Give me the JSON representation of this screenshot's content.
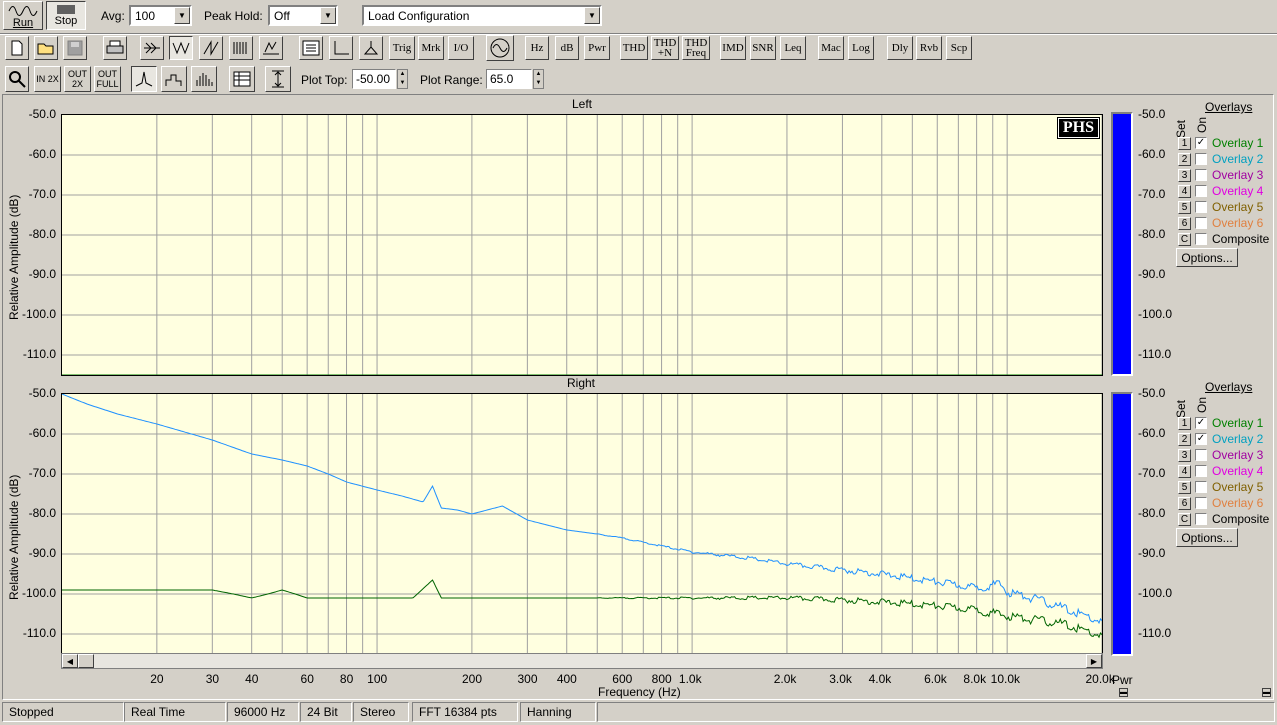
{
  "toolbar1": {
    "run": "Run",
    "stop": "Stop",
    "avg_label": "Avg:",
    "avg_value": "100",
    "peak_label": "Peak Hold:",
    "peak_value": "Off",
    "config_value": "Load Configuration"
  },
  "toolbar2": {
    "buttons": [
      "Trig",
      "Mrk",
      "I/O",
      "Hz",
      "dB",
      "Pwr",
      "THD",
      "THD +N",
      "THD Freq",
      "IMD",
      "SNR",
      "Leq",
      "Mac",
      "Log",
      "Dly",
      "Rvb",
      "Scp"
    ]
  },
  "toolbar3": {
    "plot_top_label": "Plot Top:",
    "plot_top_value": "-50.00",
    "plot_range_label": "Plot Range:",
    "plot_range_value": "65.0",
    "zoom_labels": [
      "IN 2X",
      "OUT 2X",
      "OUT FULL"
    ]
  },
  "left_panel": {
    "title": "Left",
    "ylabel": "Relative Amplitude (dB)",
    "logo": "PHS"
  },
  "right_panel": {
    "title": "Right",
    "ylabel": "Relative Amplitude (dB)"
  },
  "y_ticks": [
    "-50.0",
    "-60.0",
    "-70.0",
    "-80.0",
    "-90.0",
    "-100.0",
    "-110.0"
  ],
  "x_ticks": [
    "20",
    "30",
    "40",
    "60",
    "80",
    "100",
    "200",
    "300",
    "400",
    "600",
    "800",
    "1.0k",
    "2.0k",
    "3.0k",
    "4.0k",
    "6.0k",
    "8.0k",
    "10.0k",
    "20.0k"
  ],
  "xlabel": "Frequency (Hz)",
  "meter_label": "Pwr",
  "overlays": {
    "header": "Overlays",
    "set_label": "Set",
    "on_label": "On",
    "options": "Options...",
    "items": [
      {
        "set": "1",
        "name": "Overlay 1",
        "color": "#008000",
        "checked_left": true,
        "checked_right": true
      },
      {
        "set": "2",
        "name": "Overlay 2",
        "color": "#00a0c0",
        "checked_left": false,
        "checked_right": true
      },
      {
        "set": "3",
        "name": "Overlay 3",
        "color": "#a000a0",
        "checked_left": false,
        "checked_right": false
      },
      {
        "set": "4",
        "name": "Overlay 4",
        "color": "#e000e0",
        "checked_left": false,
        "checked_right": false
      },
      {
        "set": "5",
        "name": "Overlay 5",
        "color": "#806000",
        "checked_left": false,
        "checked_right": false
      },
      {
        "set": "6",
        "name": "Overlay 6",
        "color": "#e08040",
        "checked_left": false,
        "checked_right": false
      },
      {
        "set": "C",
        "name": "Composite",
        "color": "#000000",
        "checked_left": false,
        "checked_right": false
      }
    ]
  },
  "status": [
    "Stopped",
    "Real Time",
    "96000 Hz",
    "24 Bit",
    "Stereo",
    "FFT 16384 pts",
    "Hanning"
  ],
  "chart_data": [
    {
      "type": "line",
      "title": "Left",
      "xlabel": "Frequency (Hz)",
      "ylabel": "Relative Amplitude (dB)",
      "xscale": "log",
      "xlim": [
        10,
        20000
      ],
      "ylim": [
        -115,
        -50
      ],
      "grid": true,
      "series": [
        {
          "name": "Overlay 1",
          "color": "#008000",
          "x": [
            10,
            20000
          ],
          "y": [
            -115,
            -115
          ]
        }
      ]
    },
    {
      "type": "line",
      "title": "Right",
      "xlabel": "Frequency (Hz)",
      "ylabel": "Relative Amplitude (dB)",
      "xscale": "log",
      "xlim": [
        10,
        20000
      ],
      "ylim": [
        -115,
        -50
      ],
      "grid": true,
      "series": [
        {
          "name": "Overlay 2",
          "color": "#1e90ff",
          "x": [
            10,
            12,
            15,
            20,
            30,
            40,
            50,
            60,
            70,
            80,
            100,
            120,
            140,
            150,
            160,
            180,
            200,
            250,
            300,
            400,
            500,
            600,
            800,
            1000,
            1500,
            2000,
            3000,
            4000,
            6000,
            8000,
            9500,
            10000,
            12000,
            15000,
            20000
          ],
          "y": [
            -50,
            -52.5,
            -55,
            -57.5,
            -61.5,
            -65,
            -66.5,
            -68,
            -70,
            -72,
            -74,
            -75.5,
            -77,
            -73,
            -78.5,
            -79,
            -80,
            -78,
            -81.5,
            -84,
            -85,
            -86,
            -88,
            -89.5,
            -91,
            -92.5,
            -94,
            -95,
            -97,
            -98.5,
            -97.5,
            -99.5,
            -101,
            -103.5,
            -107
          ]
        },
        {
          "name": "Overlay 1",
          "color": "#006400",
          "x": [
            10,
            15,
            20,
            30,
            35,
            40,
            45,
            50,
            55,
            60,
            80,
            100,
            130,
            150,
            160,
            180,
            200,
            300,
            500,
            1000,
            2000,
            3000,
            4000,
            5000,
            6000,
            8000,
            10000,
            15000,
            20000
          ],
          "y": [
            -99,
            -99,
            -99,
            -99,
            -100,
            -101,
            -100,
            -99,
            -100,
            -101,
            -101,
            -101,
            -101,
            -96.5,
            -101,
            -101,
            -101,
            -101,
            -101,
            -101,
            -101,
            -101.5,
            -102,
            -102.5,
            -103,
            -104,
            -105.5,
            -107.5,
            -110.5
          ]
        }
      ]
    }
  ]
}
